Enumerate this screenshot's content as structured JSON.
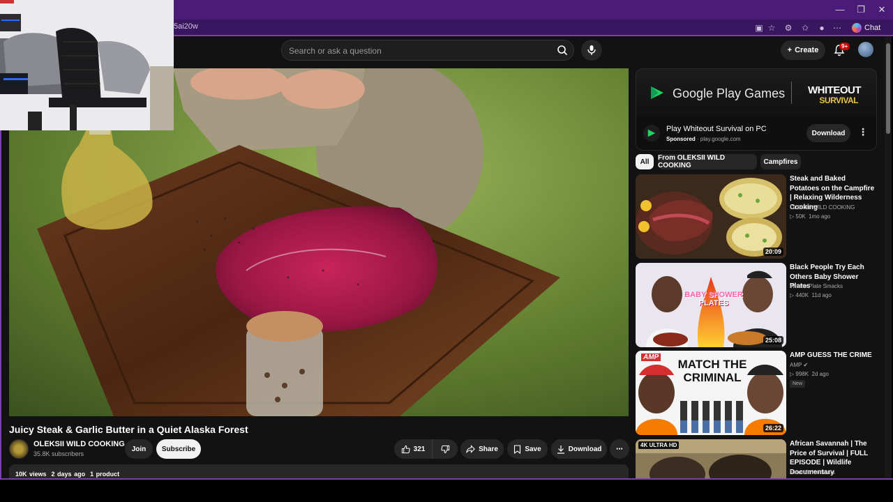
{
  "browser": {
    "url_fragment": "5ai20w",
    "chat_label": "Chat",
    "controls": {
      "minimize": "—",
      "restore": "❐",
      "close": "✕"
    }
  },
  "header": {
    "search_placeholder": "Search or ask a question",
    "create_label": "Create",
    "notification_badge": "9+"
  },
  "video": {
    "title": "Juicy Steak & Garlic Butter in a Quiet Alaska Forest",
    "channel": "OLEKSII WILD COOKING",
    "subscribers": "35.8K subscribers",
    "join_label": "Join",
    "subscribe_label": "Subscribe",
    "likes": "321",
    "share_label": "Share",
    "save_label": "Save",
    "download_label": "Download",
    "views": "10K views",
    "age": "2 days ago",
    "products": "1 product"
  },
  "ad": {
    "brand": "Google Play Games",
    "game_line1": "WHITEOUT",
    "game_line2": "SURVIVAL",
    "title": "Play Whiteout Survival on PC",
    "sponsored": "Sponsored",
    "domain": "play.google.com",
    "cta": "Download"
  },
  "chips": [
    "All",
    "From OLEKSII WILD COOKING",
    "Campfires"
  ],
  "recommendations": [
    {
      "title": "Steak and Baked Potatoes on the Campfire | Relaxing Wilderness Cooking",
      "channel": "OLEKSII WILD COOKING",
      "views": "50K",
      "age": "1mo ago",
      "duration": "20:09",
      "badge": ""
    },
    {
      "title": "Black People Try Each Others Baby Shower Plates",
      "channel": "Whose Plate Smacks",
      "views": "440K",
      "age": "11d ago",
      "duration": "25:08",
      "badge": "",
      "thumb_text1": "BABY SHOWER",
      "thumb_text2": "PLATES"
    },
    {
      "title": "AMP GUESS THE CRIME",
      "channel": "AMP",
      "views": "998K",
      "age": "2d ago",
      "duration": "26:22",
      "badge": "New",
      "thumb_text1": "MATCH THE",
      "thumb_text2": "CRIMINAL",
      "thumb_logo": "AMP"
    },
    {
      "title": "African Savannah | The Price of Survival | FULL EPISODE | Wildlife Documentary",
      "channel": "Nature's Moments",
      "views": "",
      "age": "",
      "duration": "",
      "badge": "",
      "thumb_tag": "4K ULTRA HD"
    }
  ]
}
